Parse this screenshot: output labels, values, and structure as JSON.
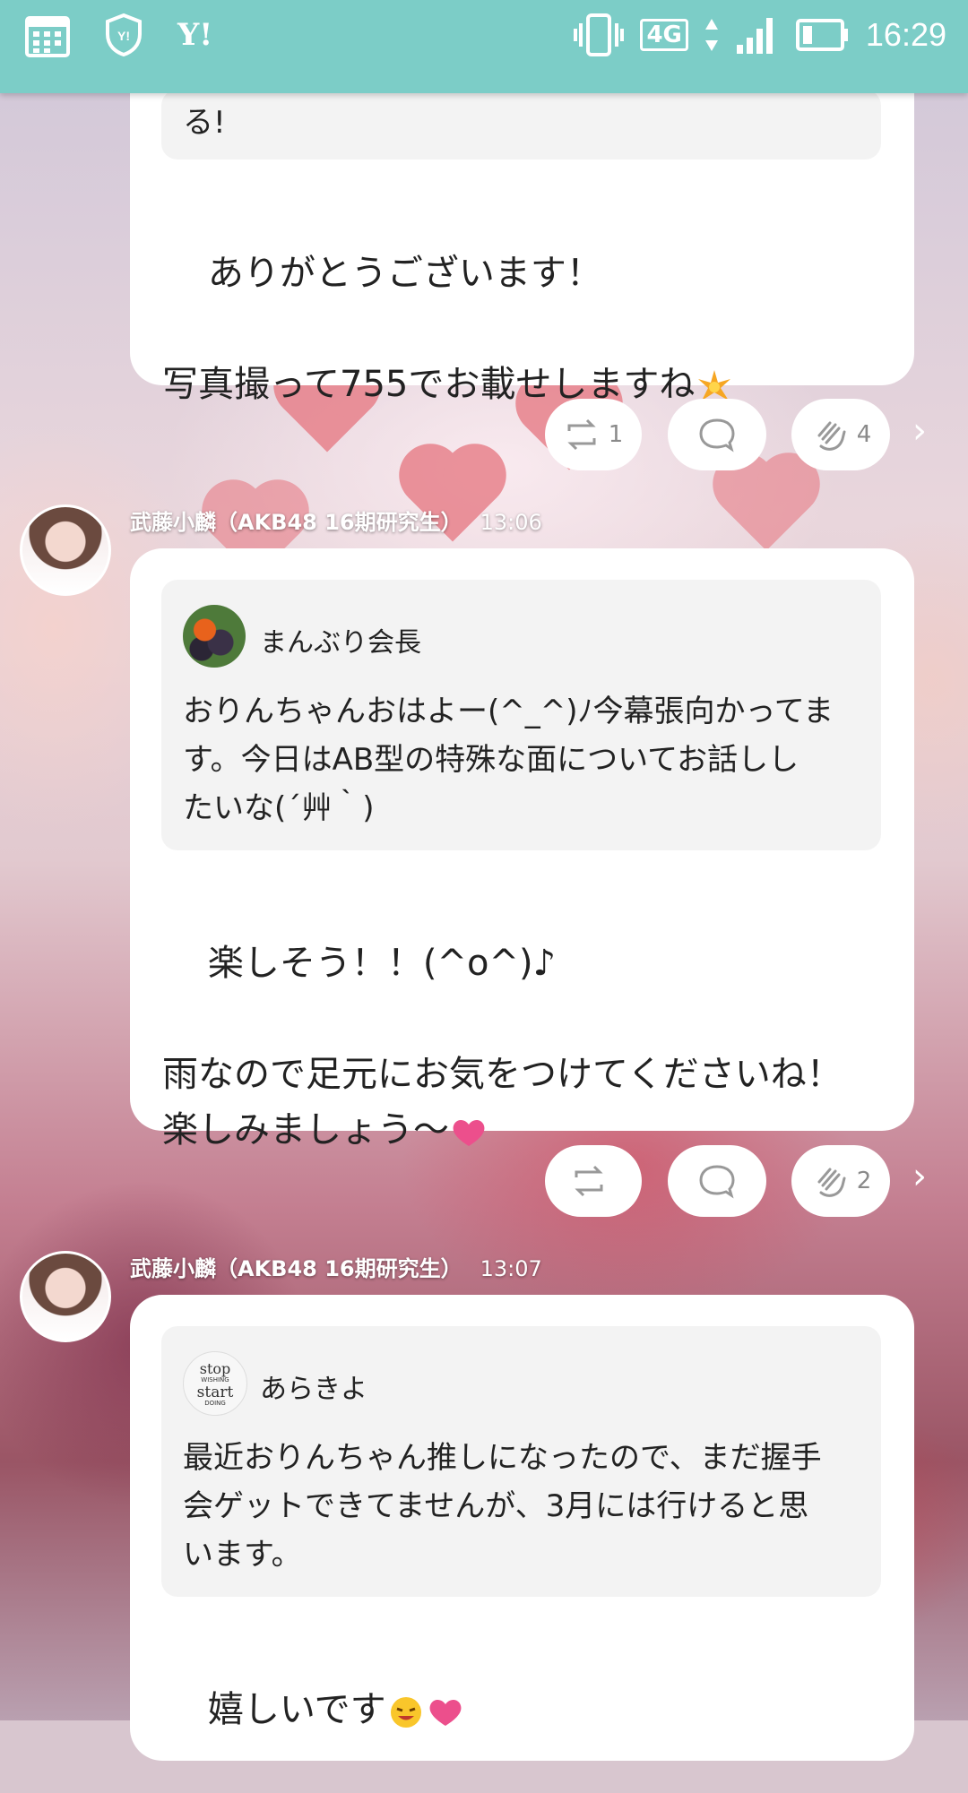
{
  "status_bar": {
    "icons_left": [
      "calendar-icon",
      "shield-icon",
      "yahoo-icon"
    ],
    "yahoo_text": "Y!",
    "network": "4G",
    "time": "16:29",
    "colors": {
      "bar": "#7ccdc7"
    }
  },
  "posts": [
    {
      "message_top_partial": "る!",
      "message": "ありがとうございます！\n\n写真撮って755でお載せしますね",
      "emoji": [
        "sparkle-icon"
      ],
      "actions": {
        "repost_count": "1",
        "comment_count": "",
        "clap_count": "4"
      }
    },
    {
      "poster": "武藤小麟（AKB48 16期研究生）",
      "time": "13:06",
      "quote": {
        "name": "まんぶり会長",
        "text": "おりんちゃんおはよー(^_^)ﾉ今幕張向かってま\nす。今日はAB型の特殊な面についてお話しし\nたいな(´艸｀)"
      },
      "message": "楽しそう！！(^o^)♪\n\n雨なので足元にお気をつけてくださいね！\n楽しみましょう〜",
      "emoji": [
        "heart-icon"
      ],
      "actions": {
        "repost_count": "",
        "comment_count": "",
        "clap_count": "2"
      }
    },
    {
      "poster": "武藤小麟（AKB48 16期研究生）",
      "time": "13:07",
      "quote": {
        "name": "あらきよ",
        "avatar_text": "stop WISHING start DOING",
        "text": "最近おりんちゃん推しになったので、まだ握手\n会ゲットできてませんが、3月には行けると思\nいます。"
      },
      "message": "嬉しいです",
      "emoji": [
        "happy-face-icon",
        "heart-icon"
      ]
    }
  ]
}
